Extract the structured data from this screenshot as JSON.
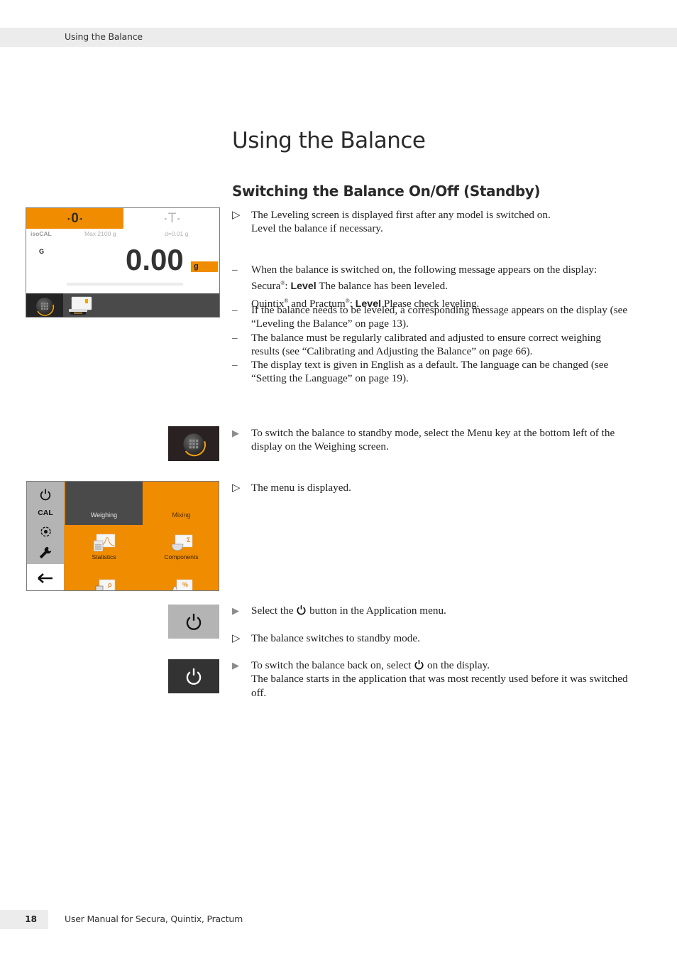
{
  "header": {
    "running_title": "Using the Balance"
  },
  "page_title": "Using the Balance",
  "section_title": "Switching the Balance On/Off (Standby)",
  "paragraphs": {
    "p1": {
      "marker": "▷",
      "line1": "The Leveling screen is displayed first after any model is switched on.",
      "line2": "Level the balance if necessary."
    },
    "bullets": [
      {
        "marker": "–",
        "intro": "When the balance is switched on, the following message appears on the display:",
        "secura_name": "Secura",
        "secura_label": "Level",
        "secura_msg": "The balance has been leveled.",
        "quintix_name": "Quintix",
        "and_text": "and Practum",
        "quintix_label": "Level",
        "quintix_msg": "Please check leveling."
      },
      {
        "marker": "–",
        "text": "If the balance needs to be leveled, a corresponding message appears on the display (see “Leveling the Balance” on page 13)."
      },
      {
        "marker": "–",
        "text": "The balance must be regularly calibrated and adjusted to ensure correct weighing results (see “Calibrating and Adjusting the Balance” on page 66)."
      },
      {
        "marker": "–",
        "text": "The display text is given in English as a default. The language can be changed (see “Setting the Language” on page 19)."
      }
    ],
    "step1": {
      "marker": "▶",
      "text": "To switch the balance to standby mode, select the Menu key at the bottom left of the display on the Weighing screen."
    },
    "result1": {
      "marker": "▷",
      "text": "The menu is displayed."
    },
    "step2": {
      "marker": "▶",
      "before": "Select the",
      "after": "button in the Application menu."
    },
    "result2": {
      "marker": "▷",
      "text": "The balance switches to standby mode."
    },
    "step3": {
      "marker": "▶",
      "before": "To switch the balance back on, select",
      "after": "on the display.",
      "line2": "The balance starts in the application that was most recently used before it was switched off."
    },
    "registered": "®"
  },
  "weighing_screen": {
    "zero_key": "0",
    "tare_key": "T",
    "iso_label": "isoCAL",
    "max_label": "Max 2100 g",
    "d_label": "d=0.01 g",
    "gross_label": "G",
    "value": "0.00",
    "unit": "g",
    "menu_icon": "menu-grid-icon",
    "app_icon": "weighing-app-icon"
  },
  "menu_screen": {
    "side_items": [
      "power-icon",
      "CAL",
      "level-icon",
      "wrench-icon"
    ],
    "cal_label": "CAL",
    "back_icon": "arrow-left-icon",
    "tabs": [
      {
        "label": "Weighing",
        "active": true
      },
      {
        "label": "Mixing",
        "active": false
      }
    ],
    "apps": [
      {
        "label": "Statistics",
        "icon": "statistics-icon"
      },
      {
        "label": "Components",
        "icon": "components-icon"
      }
    ]
  },
  "colors": {
    "accent": "#f08c00",
    "dark_panel": "#4a4a4a",
    "side_gray": "#b4b4b4"
  },
  "footer": {
    "page_number": "18",
    "text": "User Manual for Secura, Quintix, Practum"
  }
}
